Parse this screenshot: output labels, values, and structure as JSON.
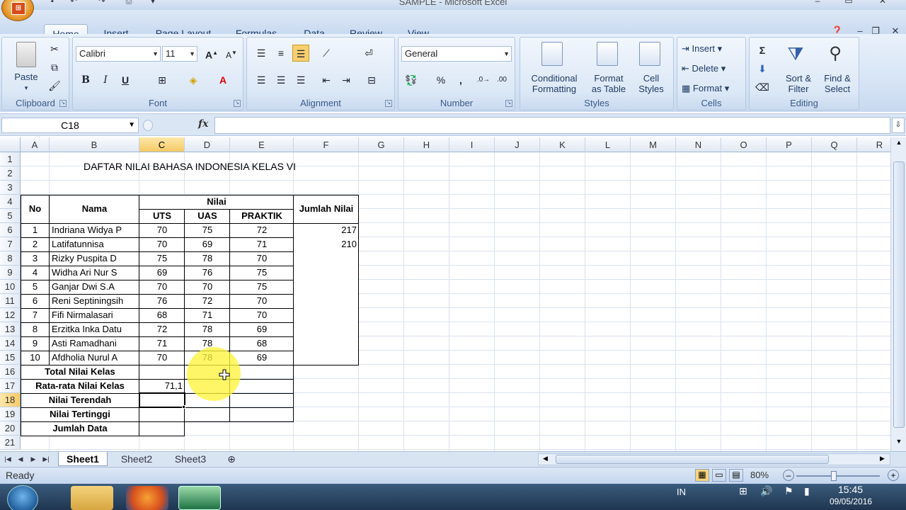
{
  "window": {
    "title": "SAMPLE - Microsoft Excel"
  },
  "ribbon_tabs": [
    "Home",
    "Insert",
    "Page Layout",
    "Formulas",
    "Data",
    "Review",
    "View"
  ],
  "ribbon": {
    "clipboard": {
      "label": "Clipboard",
      "paste": "Paste"
    },
    "font": {
      "label": "Font",
      "font_name": "Calibri",
      "font_size": "11",
      "bold": "B",
      "italic": "I",
      "underline": "U"
    },
    "alignment": {
      "label": "Alignment"
    },
    "number": {
      "label": "Number",
      "format": "General",
      "percent": "%",
      "comma": ","
    },
    "styles": {
      "label": "Styles",
      "conditional": [
        "Conditional",
        "Formatting"
      ],
      "format_table": [
        "Format",
        "as Table"
      ],
      "cell_styles": [
        "Cell",
        "Styles"
      ]
    },
    "cells": {
      "label": "Cells",
      "insert": "Insert",
      "delete": "Delete",
      "format": "Format"
    },
    "editing": {
      "label": "Editing",
      "sum": "Σ",
      "sort": [
        "Sort &",
        "Filter"
      ],
      "find": [
        "Find &",
        "Select"
      ]
    }
  },
  "formula_bar": {
    "name_box": "C18",
    "fx": "fx",
    "value": ""
  },
  "columns": [
    "A",
    "B",
    "C",
    "D",
    "E",
    "F",
    "G",
    "H",
    "I",
    "J",
    "K",
    "L",
    "M",
    "N",
    "O",
    "P",
    "Q",
    "R"
  ],
  "rows": [
    "1",
    "2",
    "3",
    "4",
    "5",
    "6",
    "7",
    "8",
    "9",
    "10",
    "11",
    "12",
    "13",
    "14",
    "15",
    "16",
    "17",
    "18",
    "19",
    "20",
    "21"
  ],
  "sheet": {
    "title": "DAFTAR NILAI BAHASA INDONESIA KELAS VI",
    "headers": {
      "no": "No",
      "nama": "Nama",
      "nilai": "Nilai",
      "uts": "UTS",
      "uas": "UAS",
      "praktik": "PRAKTIK",
      "jumlah": "Jumlah Nilai"
    },
    "students": [
      {
        "no": "1",
        "nama": "Indriana Widya P",
        "uts": "70",
        "uas": "75",
        "praktik": "72",
        "jumlah": "217"
      },
      {
        "no": "2",
        "nama": "Latifatunnisa",
        "uts": "70",
        "uas": "69",
        "praktik": "71",
        "jumlah": "210"
      },
      {
        "no": "3",
        "nama": "Rizky Puspita D",
        "uts": "75",
        "uas": "78",
        "praktik": "70",
        "jumlah": ""
      },
      {
        "no": "4",
        "nama": "Widha Ari Nur S",
        "uts": "69",
        "uas": "76",
        "praktik": "75",
        "jumlah": ""
      },
      {
        "no": "5",
        "nama": "Ganjar Dwi S.A",
        "uts": "70",
        "uas": "70",
        "praktik": "75",
        "jumlah": ""
      },
      {
        "no": "6",
        "nama": "Reni Septiningsih",
        "uts": "76",
        "uas": "72",
        "praktik": "70",
        "jumlah": ""
      },
      {
        "no": "7",
        "nama": "Fifi Nirmalasari",
        "uts": "68",
        "uas": "71",
        "praktik": "70",
        "jumlah": ""
      },
      {
        "no": "8",
        "nama": "Erzitka Inka Datu",
        "uts": "72",
        "uas": "78",
        "praktik": "69",
        "jumlah": ""
      },
      {
        "no": "9",
        "nama": "Asti Ramadhani",
        "uts": "71",
        "uas": "78",
        "praktik": "68",
        "jumlah": ""
      },
      {
        "no": "10",
        "nama": "Afdholia Nurul A",
        "uts": "70",
        "uas": "78",
        "praktik": "69",
        "jumlah": ""
      }
    ],
    "summary": [
      {
        "label": "Total Nilai Kelas",
        "value": ""
      },
      {
        "label": "Rata-rata Nilai Kelas",
        "value": "71,1"
      },
      {
        "label": "Nilai Terendah",
        "value": ""
      },
      {
        "label": "Nilai Tertinggi",
        "value": ""
      },
      {
        "label": "Jumlah Data",
        "value": ""
      }
    ]
  },
  "sheet_tabs": [
    "Sheet1",
    "Sheet2",
    "Sheet3"
  ],
  "status": {
    "text": "Ready",
    "zoom": "80%"
  },
  "taskbar": {
    "lang": "IN",
    "time": "15:45",
    "date": "09/05/2016"
  },
  "colors": {
    "accent": "#2a5699",
    "selection": "#f6c965",
    "highlight": "#fff43c",
    "excel_green": "#1f7244"
  }
}
